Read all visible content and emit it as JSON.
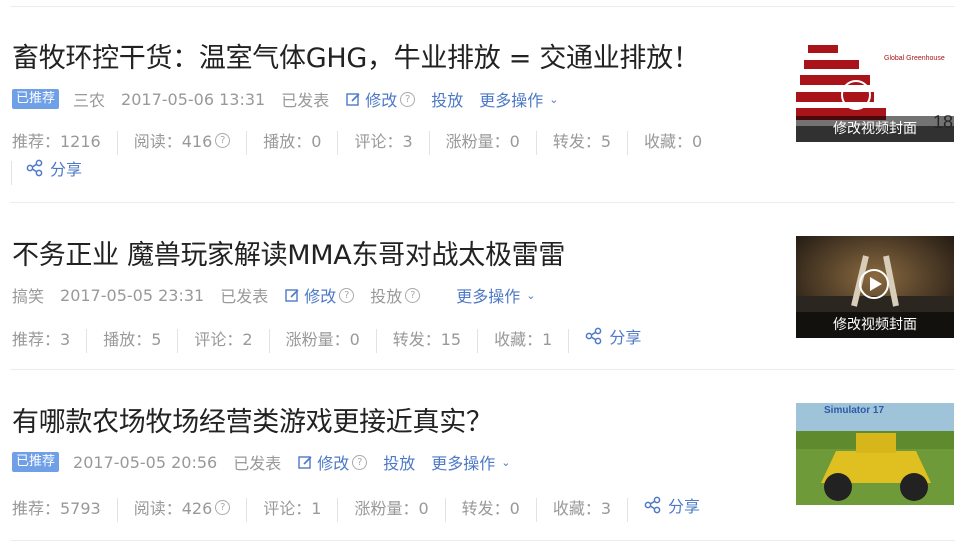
{
  "items": [
    {
      "title": "畜牧环控干货：温室气体GHG，牛业排放 = 交通业排放！",
      "badge": "已推荐",
      "category": "三农",
      "date": "2017-05-06 13:31",
      "status": "已发表",
      "edit_label": "修改",
      "boost_label": "投放",
      "more_label": "更多操作",
      "stats": [
        "推荐：1216",
        "阅读：416",
        "播放：0",
        "评论：3",
        "涨粉量：0",
        "转发：5",
        "收藏：0"
      ],
      "share_label": "分享",
      "thumb_caption": "修改视频封面",
      "thumb_text": "Global Greenhouse",
      "thumb_number": "18"
    },
    {
      "title": "不务正业 魔兽玩家解读MMA东哥对战太极雷雷",
      "category": "搞笑",
      "date": "2017-05-05 23:31",
      "status": "已发表",
      "edit_label": "修改",
      "boost_label": "投放",
      "more_label": "更多操作",
      "stats": [
        "推荐：3",
        "播放：5",
        "评论：2",
        "涨粉量：0",
        "转发：15",
        "收藏：1"
      ],
      "share_label": "分享",
      "thumb_caption": "修改视频封面"
    },
    {
      "title": "有哪款农场牧场经营类游戏更接近真实？",
      "badge": "已推荐",
      "date": "2017-05-05 20:56",
      "status": "已发表",
      "edit_label": "修改",
      "boost_label": "投放",
      "more_label": "更多操作",
      "stats": [
        "推荐：5793",
        "阅读：426",
        "评论：1",
        "涨粉量：0",
        "转发：0",
        "收藏：3"
      ],
      "share_label": "分享",
      "thumb_text": "Simulator 17"
    }
  ]
}
